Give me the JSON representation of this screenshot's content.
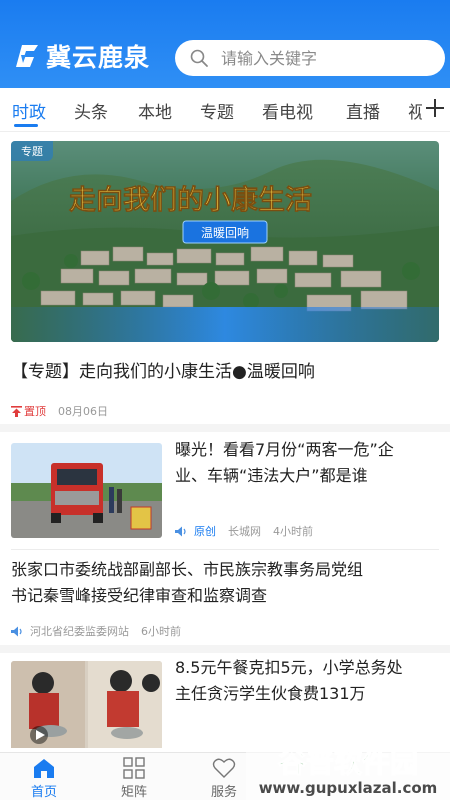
{
  "header": {
    "app_name": "冀云鹿泉",
    "search_placeholder": "请输入关键字"
  },
  "tabs": [
    {
      "label": "时政",
      "active": true
    },
    {
      "label": "头条",
      "active": false
    },
    {
      "label": "本地",
      "active": false
    },
    {
      "label": "专题",
      "active": false
    },
    {
      "label": "看电视",
      "active": false
    },
    {
      "label": "直播",
      "active": false
    },
    {
      "label": "视",
      "active": false
    }
  ],
  "featured": {
    "badge": "专题",
    "image_headline": "走向我们的小康生活",
    "image_subtitle": "温暖回响",
    "title": "【专题】走向我们的小康生活●温暖回响",
    "pinned_label": "置顶",
    "date": "08月06日"
  },
  "news": [
    {
      "title_line1": "曝光！看看7月份“两客一危”企",
      "title_line2": "业、车辆“违法大户”都是谁",
      "tag": "原创",
      "source": "长城网",
      "time": "4小时前"
    },
    {
      "title_line1": "张家口市委统战部副部长、市民族宗教事务局党组",
      "title_line2": "书记秦雪峰接受纪律审查和监察调查",
      "source": "河北省纪委监委网站",
      "time": "6小时前"
    },
    {
      "title_line1": "8.5元午餐克扣5元，小学总务处",
      "title_line2": "主任贪污学生伙食费131万"
    }
  ],
  "bottom_nav": [
    {
      "label": "首页",
      "icon": "home-icon",
      "active": true
    },
    {
      "label": "矩阵",
      "icon": "grid-icon",
      "active": false
    },
    {
      "label": "服务",
      "icon": "heart-icon",
      "active": false
    }
  ],
  "watermark": {
    "title": "谷普软件园",
    "url": "www.gupuxlazal.com"
  },
  "colors": {
    "accent": "#1a7cf0",
    "pinned": "#e03c3c"
  }
}
